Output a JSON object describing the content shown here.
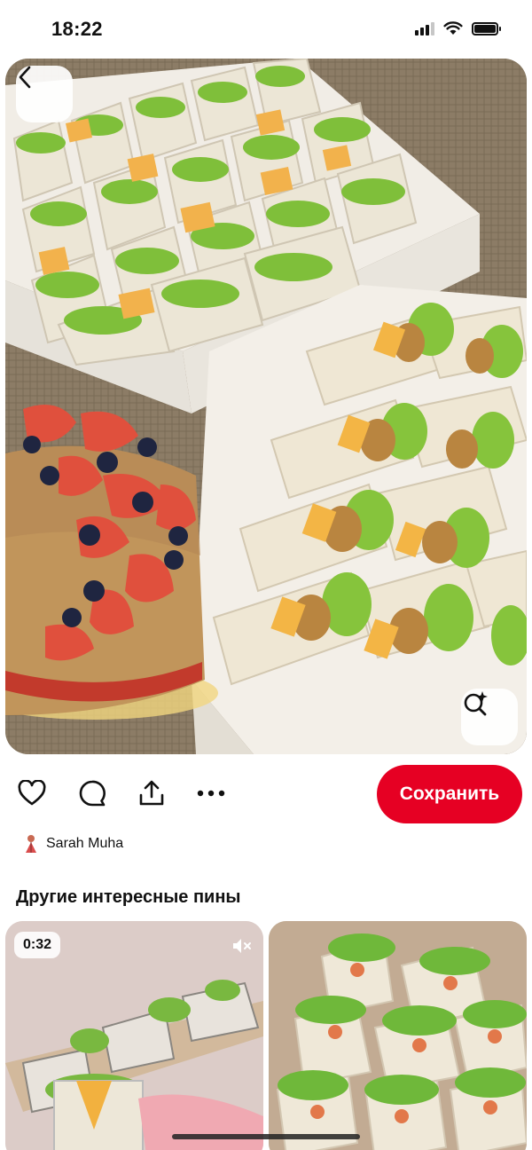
{
  "status_bar": {
    "time": "18:22"
  },
  "pin": {
    "image_icons": {
      "back": "chevron-left-icon",
      "lens": "visual-search-icon"
    }
  },
  "actions": {
    "icons": [
      "heart-icon",
      "comment-icon",
      "share-icon",
      "more-icon"
    ],
    "save_label": "Сохранить"
  },
  "author": {
    "name": "Sarah Muha"
  },
  "related": {
    "title": "Другие интересные пины",
    "pins": [
      {
        "duration": "0:32",
        "muted": true
      },
      {
        "duration": null
      }
    ]
  },
  "colors": {
    "accent": "#e60023"
  }
}
